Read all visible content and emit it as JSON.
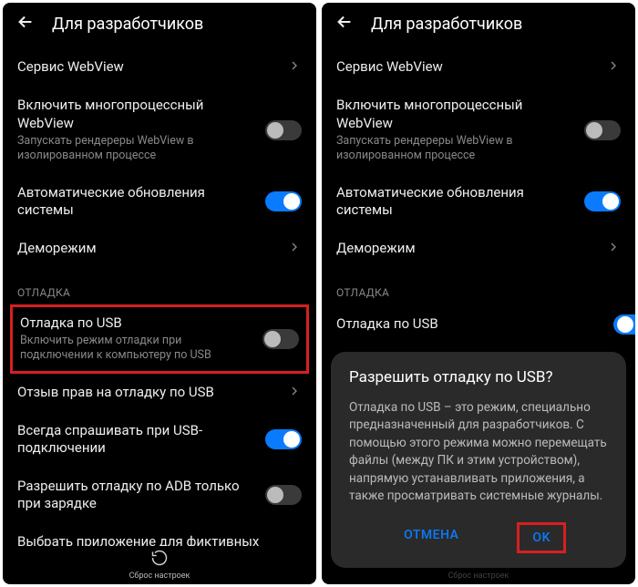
{
  "header": {
    "title": "Для разработчиков"
  },
  "left": {
    "webview_service": "Сервис WebView",
    "multiprocess_title": "Включить многопроцессный WebView",
    "multiprocess_sub": "Запускать рендереры WebView в изолированном процессе",
    "auto_updates": "Автоматические обновления системы",
    "demo_mode": "Деморежим",
    "debug_section": "ОТЛАДКА",
    "usb_debug_title": "Отладка по USB",
    "usb_debug_sub": "Включить режим отладки при подключении к компьютеру по USB",
    "revoke_usb": "Отзыв прав на отладку по USB",
    "always_ask": "Всегда спрашивать при USB-подключении",
    "adb_charge": "Разрешить отладку по ADB только при зарядке",
    "mock_app": "Выбрать приложение для фиктивных"
  },
  "right": {
    "webview_service": "Сервис WebView",
    "multiprocess_title": "Включить многопроцессный WebView",
    "multiprocess_sub": "Запускать рендереры WebView в изолированном процессе",
    "auto_updates": "Автоматические обновления системы",
    "demo_mode": "Деморежим",
    "debug_section": "ОТЛАДКА",
    "usb_debug_title": "Отладка по USB"
  },
  "dialog": {
    "title": "Разрешить отладку по USB?",
    "body": "Отладка по USB – это режим, специально предназначенный для разработчиков. С помощью этого режима можно перемещать файлы (между ПК и этим устройством), напрямую устанавливать приложения, а также просматривать системные журналы.",
    "cancel": "ОТМЕНА",
    "ok": "OK"
  },
  "bottom": {
    "label": "Сброс настроек"
  }
}
